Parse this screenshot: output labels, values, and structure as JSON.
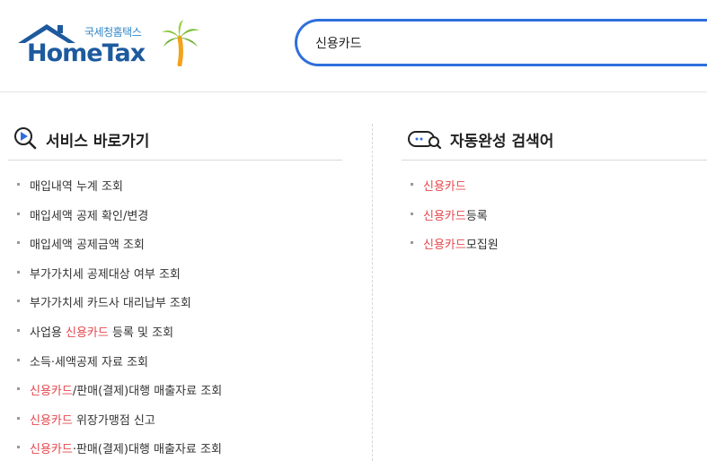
{
  "logo": {
    "kr_text": "국세청홈택스",
    "en_text": "HomeTax"
  },
  "search": {
    "value": "신용카드"
  },
  "services": {
    "title": "서비스 바로가기",
    "items": [
      {
        "before": "매입내역 누계 조회",
        "hl": "",
        "after": ""
      },
      {
        "before": "매입세액 공제 확인/변경",
        "hl": "",
        "after": ""
      },
      {
        "before": "매입세액 공제금액 조회",
        "hl": "",
        "after": ""
      },
      {
        "before": "부가가치세 공제대상 여부 조회",
        "hl": "",
        "after": ""
      },
      {
        "before": "부가가치세 카드사 대리납부 조회",
        "hl": "",
        "after": ""
      },
      {
        "before": "사업용 ",
        "hl": "신용카드",
        "after": " 등록 및 조회"
      },
      {
        "before": "소득·세액공제 자료 조회",
        "hl": "",
        "after": ""
      },
      {
        "before": "",
        "hl": "신용카드",
        "after": "/판매(결제)대행 매출자료 조회"
      },
      {
        "before": "",
        "hl": "신용카드",
        "after": " 위장가맹점 신고"
      },
      {
        "before": "",
        "hl": "신용카드",
        "after": "·판매(결제)대행 매출자료 조회"
      }
    ]
  },
  "autocomplete": {
    "title": "자동완성 검색어",
    "items": [
      {
        "hl": "신용카드",
        "after": ""
      },
      {
        "hl": "신용카드",
        "after": "등록"
      },
      {
        "hl": "신용카드",
        "after": "모집원"
      }
    ]
  },
  "colors": {
    "accent": "#2f6fdc",
    "highlight": "#e5484d",
    "logo_blue": "#1d5a9e"
  }
}
